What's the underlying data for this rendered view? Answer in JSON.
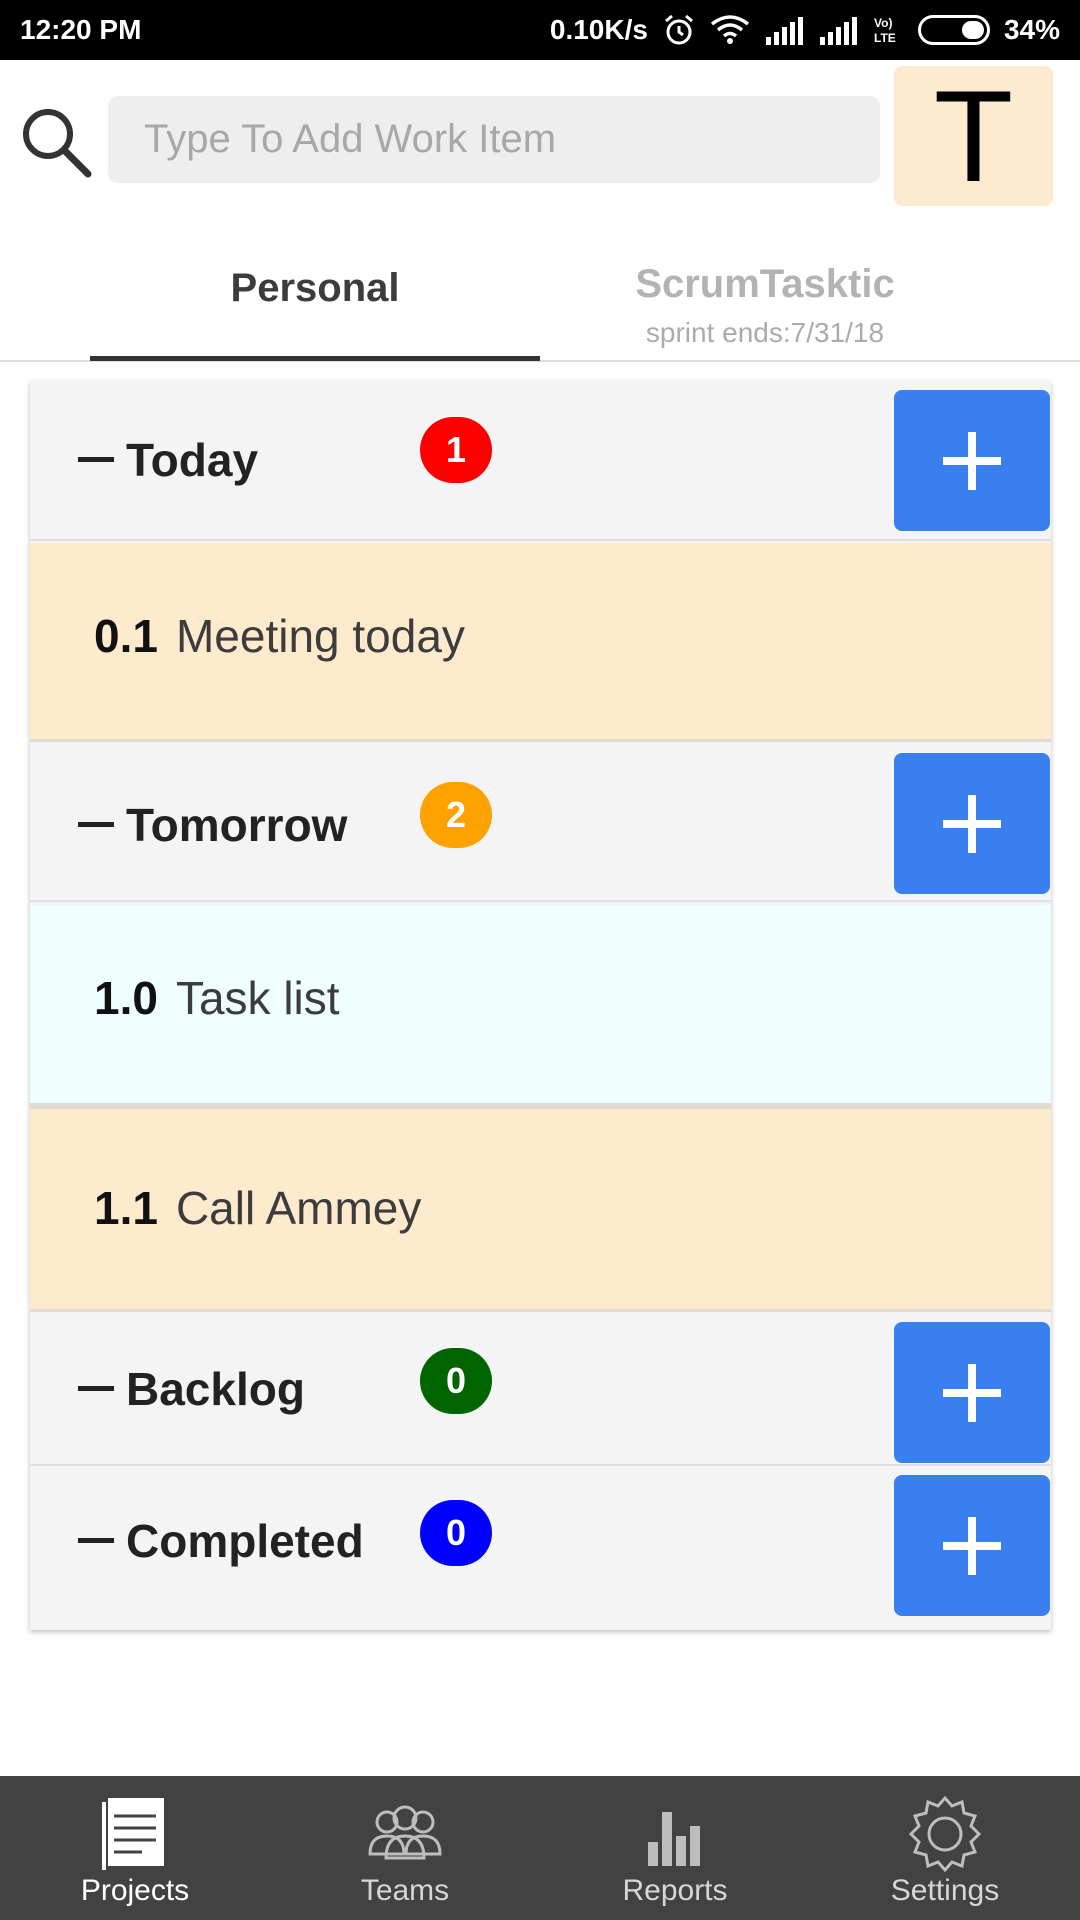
{
  "status_bar": {
    "time": "12:20 PM",
    "net_speed": "0.10K/s",
    "battery": "34%",
    "icons": [
      "alarm-icon",
      "wifi-icon",
      "signal-icon",
      "signal-icon",
      "volte-icon",
      "battery-icon"
    ],
    "volte_label": "Vo)\nLTE"
  },
  "search": {
    "placeholder": "Type To Add Work Item",
    "value": ""
  },
  "avatar": {
    "letter": "T",
    "color": "#fdebcf"
  },
  "tabs": [
    {
      "label": "Personal",
      "active": true
    },
    {
      "label": "ScrumTasktic",
      "subtitle": "sprint ends:7/31/18",
      "active": false
    }
  ],
  "sections": {
    "today": {
      "label": "Today",
      "count": "1",
      "badge_color": "#ff0000"
    },
    "tomorrow": {
      "label": "Tomorrow",
      "count": "2",
      "badge_color": "#ffa200"
    },
    "backlog": {
      "label": "Backlog",
      "count": "0",
      "badge_color": "#006400"
    },
    "completed": {
      "label": "Completed",
      "count": "0",
      "badge_color": "#0000ff"
    }
  },
  "items": [
    {
      "number": "0.1",
      "text": "Meeting today",
      "color": "#feebcd"
    },
    {
      "number": "1.0",
      "text": "Task list",
      "color": "#effefe"
    },
    {
      "number": "1.1",
      "text": "Call Ammey",
      "color": "#feebcd"
    }
  ],
  "colors": {
    "accent": "#3a7ff0",
    "nav_bg": "#424242"
  },
  "bottom_nav": [
    {
      "label": "Projects",
      "icon": "projects-icon",
      "active": true
    },
    {
      "label": "Teams",
      "icon": "teams-icon",
      "active": false
    },
    {
      "label": "Reports",
      "icon": "reports-icon",
      "active": false
    },
    {
      "label": "Settings",
      "icon": "settings-icon",
      "active": false
    }
  ]
}
